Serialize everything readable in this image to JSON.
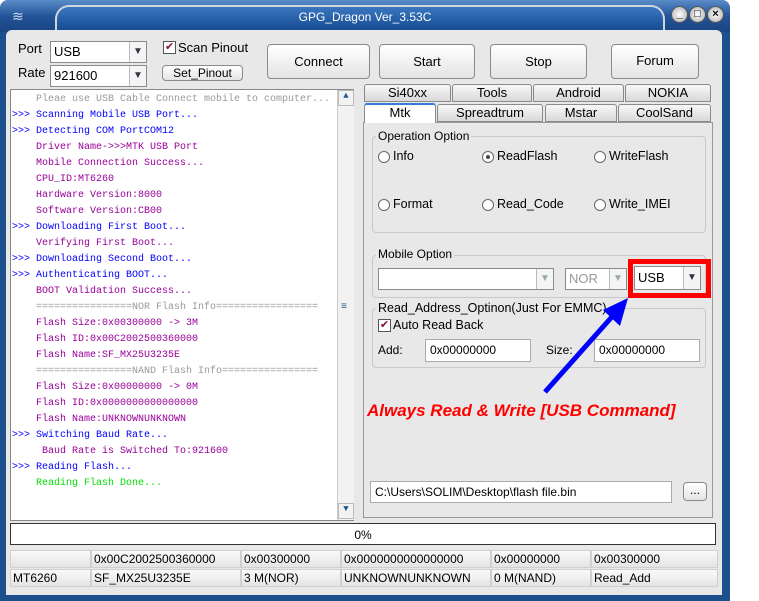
{
  "window": {
    "title": "GPG_Dragon  Ver_3.53C",
    "controls": [
      "minimize",
      "maximize",
      "close"
    ]
  },
  "port": {
    "label": "Port",
    "value": "USB"
  },
  "rate": {
    "label": "Rate",
    "value": "921600"
  },
  "scan_pinout": {
    "label": "Scan Pinout",
    "checked": true
  },
  "set_pinout": "Set_Pinout",
  "buttons": {
    "connect": "Connect",
    "start": "Start",
    "stop": "Stop",
    "forum": "Forum"
  },
  "log": [
    {
      "prefix": "",
      "text": "Pleae use USB Cable Connect mobile to computer...",
      "color": "#999999"
    },
    {
      "prefix": ">>>",
      "text": "Scanning Mobile USB Port...",
      "color": "#0000ff"
    },
    {
      "prefix": ">>>",
      "text": "Detecting COM PortCOM12",
      "color": "#0000ff"
    },
    {
      "prefix": "",
      "text": "Driver Name->>>MTK USB Port",
      "color": "#990099"
    },
    {
      "prefix": "",
      "text": "Mobile Connection Success...",
      "color": "#990099"
    },
    {
      "prefix": "",
      "text": "CPU_ID:MT6260",
      "color": "#990099"
    },
    {
      "prefix": "",
      "text": "Hardware Version:8000",
      "color": "#990099"
    },
    {
      "prefix": "",
      "text": "Software Version:CB00",
      "color": "#990099"
    },
    {
      "prefix": ">>>",
      "text": "Downloading First Boot...",
      "color": "#0000ff"
    },
    {
      "prefix": "",
      "text": "Verifying First Boot...",
      "color": "#990099"
    },
    {
      "prefix": ">>>",
      "text": "Downloading Second Boot...",
      "color": "#0000ff"
    },
    {
      "prefix": ">>>",
      "text": "Authenticating BOOT...",
      "color": "#0000ff"
    },
    {
      "prefix": "",
      "text": "BOOT Validation Success...",
      "color": "#990099"
    },
    {
      "prefix": "",
      "text": "================NOR Flash Info=================",
      "color": "#999999"
    },
    {
      "prefix": "",
      "text": "Flash Size:0x00300000 -> 3M",
      "color": "#990099"
    },
    {
      "prefix": "",
      "text": "Flash ID:0x00C2002500360000",
      "color": "#990099"
    },
    {
      "prefix": "",
      "text": "Flash Name:SF_MX25U3235E",
      "color": "#990099"
    },
    {
      "prefix": "",
      "text": "================NAND Flash Info================",
      "color": "#999999"
    },
    {
      "prefix": "",
      "text": "Flash Size:0x00000000 -> 0M",
      "color": "#990099"
    },
    {
      "prefix": "",
      "text": "Flash ID:0x0000000000000000",
      "color": "#990099"
    },
    {
      "prefix": "",
      "text": "Flash Name:UNKNOWNUNKNOWN",
      "color": "#990099"
    },
    {
      "prefix": ">>>",
      "text": "Switching Baud Rate...",
      "color": "#0000ff"
    },
    {
      "prefix": "",
      "text": " Baud Rate is Switched To:921600",
      "color": "#990099"
    },
    {
      "prefix": ">>>",
      "text": "Reading Flash...",
      "color": "#0000ff"
    },
    {
      "prefix": "",
      "text": "Reading Flash Done...",
      "color": "#00dd00"
    }
  ],
  "tabs_row1": [
    "Si40xx",
    "Tools",
    "Android",
    "NOKIA"
  ],
  "tabs_row2": [
    "Mtk",
    "Spreadtrum",
    "Mstar",
    "CoolSand"
  ],
  "active_tab": "Mtk",
  "operation_option": {
    "label": "Operation Option",
    "options": [
      "Info",
      "ReadFlash",
      "WriteFlash",
      "Format",
      "Read_Code",
      "Write_IMEI"
    ],
    "selected": "ReadFlash"
  },
  "mobile_option": {
    "label": "Mobile Option",
    "model": "",
    "memory": "NOR",
    "interface": "USB"
  },
  "read_address": {
    "label": "Read_Address_Optinon(Just For EMMC)",
    "auto_read_back": "Auto Read Back",
    "auto_checked": true,
    "add_label": "Add:",
    "add_value": "0x00000000",
    "size_label": "Size:",
    "size_value": "0x00000000"
  },
  "annotation": {
    "text": "Always Read & Write [USB Command]",
    "color": "#ff0000",
    "arrow_color": "#0000ff"
  },
  "file_path": "C:\\Users\\SOLIM\\Desktop\\flash file.bin",
  "browse": "...",
  "progress": {
    "percent": 0,
    "label": "0%"
  },
  "status_rows": [
    [
      "",
      "0x00C2002500360000",
      "0x00300000",
      "0x0000000000000000",
      "0x00000000",
      "0x00300000"
    ],
    [
      "MT6260",
      "SF_MX25U3235E",
      "3 M(NOR)",
      "UNKNOWNUNKNOWN",
      "0 M(NAND)",
      "Read_Add"
    ]
  ]
}
